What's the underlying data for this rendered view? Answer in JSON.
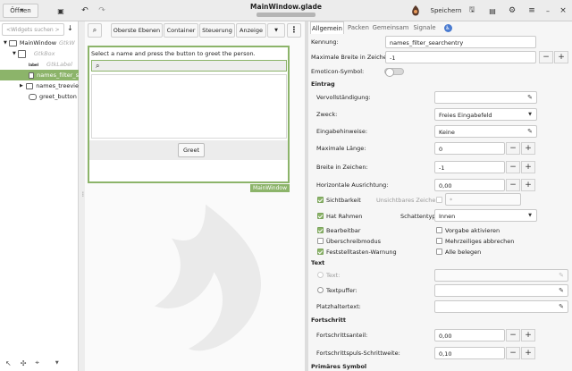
{
  "header": {
    "open_label": "Öffnen",
    "title": "MainWindow.glade",
    "save_label": "Speichern"
  },
  "widgets": {
    "search_placeholder": "<Widgets suchen >",
    "tree": [
      {
        "name": "MainWindow",
        "type": "GtkW"
      },
      {
        "name": "",
        "type": "GtkBox"
      },
      {
        "name": "",
        "type": "GtkLabel"
      },
      {
        "name": "names_filter_s",
        "type": ""
      },
      {
        "name": "names_treevie",
        "type": ""
      },
      {
        "name": "greet_button",
        "type": ""
      }
    ]
  },
  "toolbar": {
    "top_levels": "Oberste Ebenen",
    "container": "Container",
    "control": "Steuerung",
    "display": "Anzeige"
  },
  "preview": {
    "label": "Select a name and press the button to greet the person.",
    "button": "Greet",
    "window_tag": "MainWindow"
  },
  "tabs": [
    "Allgemein",
    "Packen",
    "Gemeinsam",
    "Signale"
  ],
  "props": {
    "id_label": "Kennung:",
    "id_value": "names_filter_searchentry",
    "maxw_label": "Maximale Breite in Zeichen:",
    "maxw_value": "-1",
    "emoji_label": "Emoticon-Symbol:",
    "section_entry": "Eintrag",
    "completion_label": "Vervollständigung:",
    "purpose_label": "Zweck:",
    "purpose_value": "Freies Eingabefeld",
    "hints_label": "Eingabehinweise:",
    "hints_value": "Keine",
    "maxlen_label": "Maximale Länge:",
    "maxlen_value": "0",
    "width_label": "Breite in Zeichen:",
    "width_value": "-1",
    "halign_label": "Horizontale Ausrichtung:",
    "halign_value": "0,00",
    "visibility_label": "Sichtbarkeit",
    "invis_label": "Unsichtbares Zeichen:",
    "invis_value": "*",
    "frame_label": "Hat Rahmen",
    "shadow_label": "Schattentyp:",
    "shadow_value": "Innen",
    "editable_label": "Bearbeitbar",
    "activate_label": "Vorgabe aktivieren",
    "overwrite_label": "Überschreibmodus",
    "truncate_label": "Mehrzeiliges abbrechen",
    "capslock_label": "Feststelltasten-Warnung",
    "fill_label": "Alle belegen",
    "section_text": "Text",
    "text_label": "Text:",
    "buffer_label": "Textpuffer:",
    "placeholder_label": "Platzhaltertext:",
    "section_progress": "Fortschritt",
    "fraction_label": "Fortschrittsanteil:",
    "fraction_value": "0,00",
    "pulse_label": "Fortschrittspuls-Schrittweite:",
    "pulse_value": "0,10",
    "section_primary": "Primäres Symbol"
  }
}
